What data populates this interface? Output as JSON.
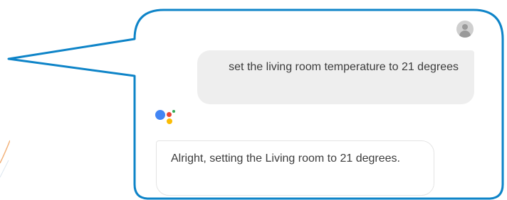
{
  "conversation": {
    "user_avatar_icon": "account-circle-icon",
    "user_message": "set the living room temperature to 21 degrees",
    "assistant_icon": "google-assistant-logo-icon",
    "assistant_message": "Alright, setting the Living room to 21 degrees."
  },
  "colors": {
    "callout_border": "#0e84c8",
    "user_bubble_bg": "#eeeeee",
    "assistant_bubble_bg": "#ffffff",
    "text": "#3c3c3c",
    "assistant_blue": "#4285F4",
    "assistant_red": "#EA4335",
    "assistant_yellow": "#FBBC05",
    "assistant_green": "#34A853"
  }
}
